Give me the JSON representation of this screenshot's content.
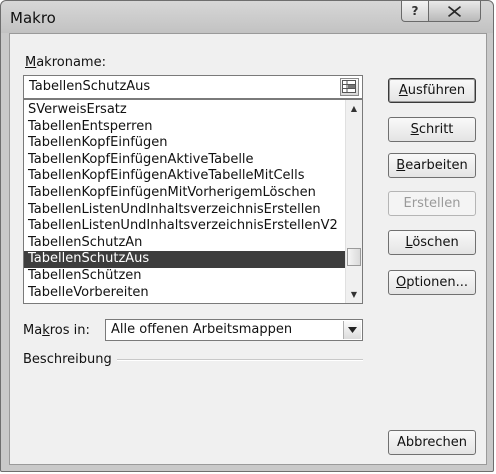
{
  "window": {
    "title": "Makro",
    "help_label": "?"
  },
  "macro_name": {
    "label_accel": "M",
    "label_rest": "akroname:",
    "value": "TabellenSchutzAus"
  },
  "macro_list": {
    "items": [
      "SVerweisErsatz",
      "TabellenEntsperren",
      "TabellenKopfEinfügen",
      "TabellenKopfEinfügenAktiveTabelle",
      "TabellenKopfEinfügenAktiveTabelleMitCells",
      "TabellenKopfEinfügenMitVorherigemLöschen",
      "TabellenListenUndInhaltsverzeichnisErstellen",
      "TabellenListenUndInhaltsverzeichnisErstellenV2",
      "TabellenSchutzAn",
      "TabellenSchutzAus",
      "TabellenSchützen",
      "TabelleVorbereiten"
    ],
    "selected_index": 9
  },
  "buttons": {
    "run": {
      "accel": "A",
      "rest": "usführen"
    },
    "step": {
      "accel": "S",
      "rest": "chritt"
    },
    "edit": {
      "accel": "B",
      "rest": "earbeiten"
    },
    "create": {
      "label": "Erstellen"
    },
    "delete": {
      "accel": "L",
      "rest": "öschen"
    },
    "options": {
      "accel": "O",
      "rest": "ptionen..."
    },
    "cancel": {
      "label": "Abbrechen"
    }
  },
  "macros_in": {
    "label_pre": "Ma",
    "label_accel": "k",
    "label_post": "ros in:",
    "value": "Alle offenen Arbeitsmappen"
  },
  "description": {
    "label": "Beschreibung"
  },
  "colors": {
    "selection": "#3d3d3d",
    "dialog_bg": "#f0f0f0",
    "frame": "#c9c9c9"
  },
  "icons": {
    "help": "question-mark-icon",
    "close": "close-x-icon",
    "ref": "range-reference-icon",
    "dropdown": "chevron-down-icon"
  }
}
